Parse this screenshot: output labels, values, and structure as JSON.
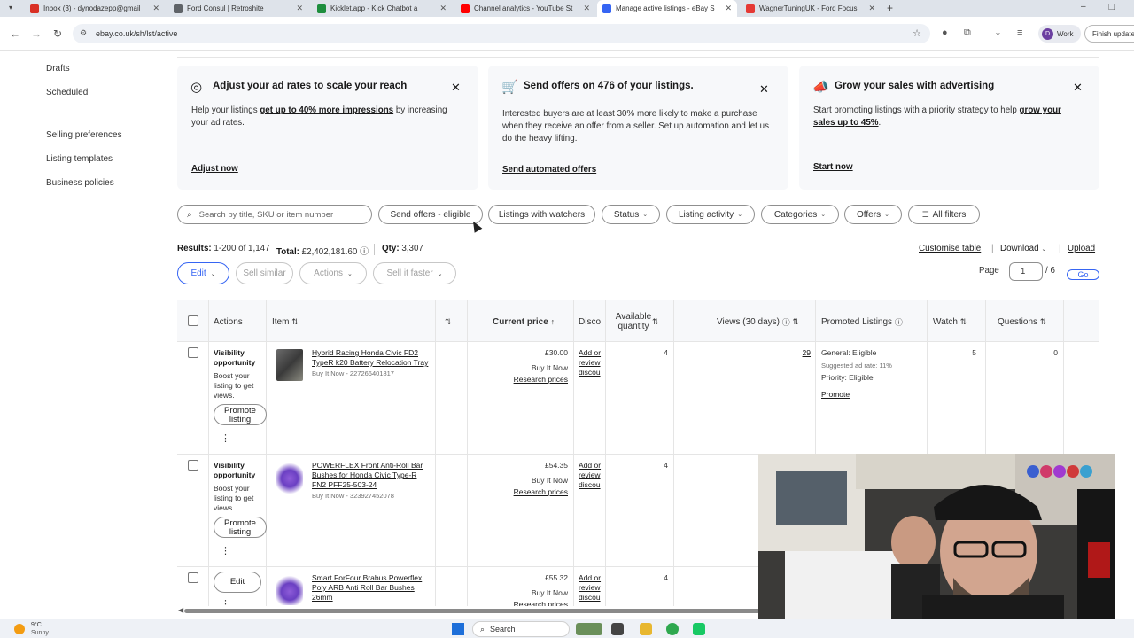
{
  "browser": {
    "tabs": [
      {
        "label": "Inbox (3) - dynodazepp@gmail",
        "color": "#d93025"
      },
      {
        "label": "Ford Consul | Retroshite",
        "color": "#5f6368"
      },
      {
        "label": "Kicklet.app - Kick Chatbot a",
        "color": "#1e8e3e"
      },
      {
        "label": "Channel analytics - YouTube St",
        "color": "#ff0000"
      },
      {
        "label": "Manage active listings - eBay S",
        "color": "#3665f3"
      },
      {
        "label": "WagnerTuningUK - Ford Focus",
        "color": "#e53935"
      }
    ],
    "url": "ebay.co.uk/sh/lst/active",
    "profile_initial": "D",
    "profile_label": "Work",
    "update_label": "Finish update"
  },
  "sidebar": {
    "items": [
      "Drafts",
      "Scheduled",
      "Selling preferences",
      "Listing templates",
      "Business policies"
    ]
  },
  "promos": [
    {
      "title": "Adjust your ad rates to scale your reach",
      "body_pre": "Help your listings ",
      "body_bold": "get up to 40% more impressions",
      "body_post": " by increasing your ad rates.",
      "link": "Adjust now"
    },
    {
      "title": "Send offers on 476 of your listings.",
      "body_pre": "Interested buyers are at least 30% more likely to make a purchase when they receive an offer from a seller. Set up automation and let us do the heavy lifting.",
      "body_bold": "",
      "body_post": "",
      "link": "Send automated offers"
    },
    {
      "title": "Grow your sales with advertising",
      "body_pre": "Start promoting listings with a priority strategy to help ",
      "body_bold": "grow your sales up to 45%",
      "body_post": ".",
      "link": "Start now"
    }
  ],
  "filters": {
    "search_placeholder": "Search by title, SKU or item number",
    "pills": [
      "Send offers - eligible",
      "Listings with watchers",
      "Status",
      "Listing activity",
      "Categories",
      "Offers",
      "All filters"
    ]
  },
  "results": {
    "label": "Results:",
    "range": "1-200 of 1,147",
    "total_label": "Total:",
    "total": "£2,402,181.60",
    "qty_label": "Qty:",
    "qty": "3,307",
    "customise": "Customise table",
    "download": "Download",
    "upload": "Upload"
  },
  "toolbar": {
    "edit": "Edit",
    "sell_similar": "Sell similar",
    "actions": "Actions",
    "sell_faster": "Sell it faster",
    "page_label": "Page",
    "page_value": "1",
    "page_total": "/ 6",
    "go": "Go"
  },
  "table": {
    "headers": {
      "actions": "Actions",
      "item": "Item",
      "price": "Current price",
      "disco": "Disco",
      "avail": "Available quantity",
      "views": "Views (30 days)",
      "promoted": "Promoted Listings",
      "watch": "Watch",
      "questions": "Questions"
    },
    "rows": [
      {
        "vis_title": "Visibility opportunity",
        "vis_body": "Boost your listing to get views.",
        "action_btn": "Promote listing",
        "title": "Hybrid Racing Honda Civic FD2 TypeR k20 Battery Relocation Tray",
        "sub": "Buy It Now - 227266401817",
        "price": "£30.00",
        "format": "Buy It Now",
        "research": "Research prices",
        "disc": "Add or review discou",
        "avail": "4",
        "views": "29",
        "promo_general": "General: Eligible",
        "promo_rate": "Suggested ad rate: 11%",
        "promo_priority": "Priority: Eligible",
        "promo_link": "Promote",
        "watchers": "5",
        "questions": "0"
      },
      {
        "vis_title": "Visibility opportunity",
        "vis_body": "Boost your listing to get views.",
        "action_btn": "Promote listing",
        "title": "POWERFLEX Front Anti-Roll Bar Bushes for Honda Civic Type-R FN2 PFF25-503-24",
        "sub": "Buy It Now - 323927452078",
        "price": "£54.35",
        "format": "Buy It Now",
        "research": "Research prices",
        "disc": "Add or review discou",
        "avail": "4"
      },
      {
        "action_btn": "Edit",
        "title": "Smart ForFour Brabus Powerflex Poly ARB Anti Roll Bar Bushes 26mm",
        "price": "£55.32",
        "format": "Buy It Now",
        "research": "Research prices",
        "disc": "Add or review discou",
        "avail": "4"
      }
    ]
  },
  "taskbar": {
    "temp": "9°C",
    "weather": "Sunny",
    "search": "Search"
  },
  "colors": {
    "accent": "#3665f3",
    "card_bg": "#f7f8fa"
  }
}
